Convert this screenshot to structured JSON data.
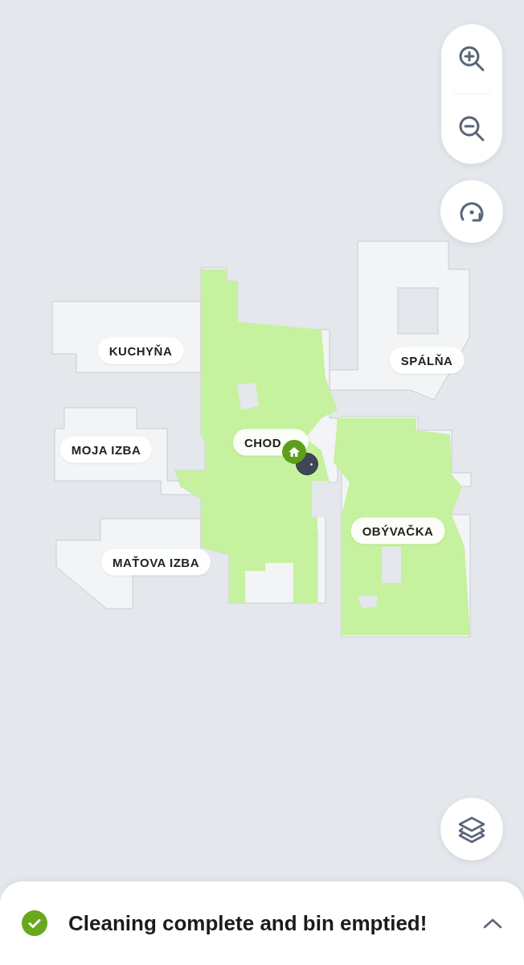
{
  "map": {
    "room_labels": [
      {
        "name": "KUCHYŇA"
      },
      {
        "name": "SPÁLŇA"
      },
      {
        "name": "MOJA IZBA"
      },
      {
        "name": "CHOD"
      },
      {
        "name": "OBÝVAČKA"
      },
      {
        "name": "MAŤOVA IZBA"
      }
    ]
  },
  "notification": {
    "message": "Cleaning complete and bin emptied!"
  }
}
